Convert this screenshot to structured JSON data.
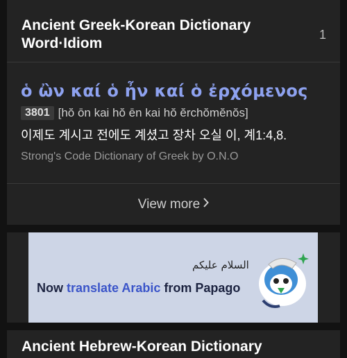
{
  "dictionary_card": {
    "title": "Ancient Greek-Korean Dictionary Word·Idiom",
    "count": "1",
    "entry": {
      "word": "ὁ ὢν καί ὁ ἦν καί ὁ ἐρχόμενος",
      "number": "3801",
      "pronunciation": "[hŏ ōn kai hŏ ēn kai hŏ ĕrchŏmĕnŏs]",
      "definition": "이제도 계시고 전에도 계셨고 장차 오실 이, 계1:4,8.",
      "source": "Strong's Code Dictionary of Greek by O.N.O"
    },
    "view_more": "View more",
    "view_more_icon": "chevron-right-icon"
  },
  "ad": {
    "arabic": "السلام عليكم",
    "text_prefix": "Now ",
    "text_highlight": "translate Arabic",
    "text_suffix": " from Papago",
    "accent": "#3b55c9",
    "background": "#cdd5e6"
  },
  "next_card": {
    "title": "Ancient Hebrew-Korean Dictionary"
  }
}
